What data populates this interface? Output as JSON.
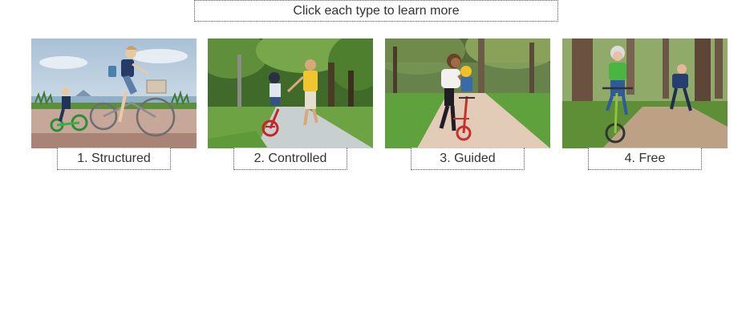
{
  "instruction": "Click each type to learn more",
  "cards": [
    {
      "label": "1. Structured"
    },
    {
      "label": "2. Controlled"
    },
    {
      "label": "3. Guided"
    },
    {
      "label": "4. Free"
    }
  ]
}
